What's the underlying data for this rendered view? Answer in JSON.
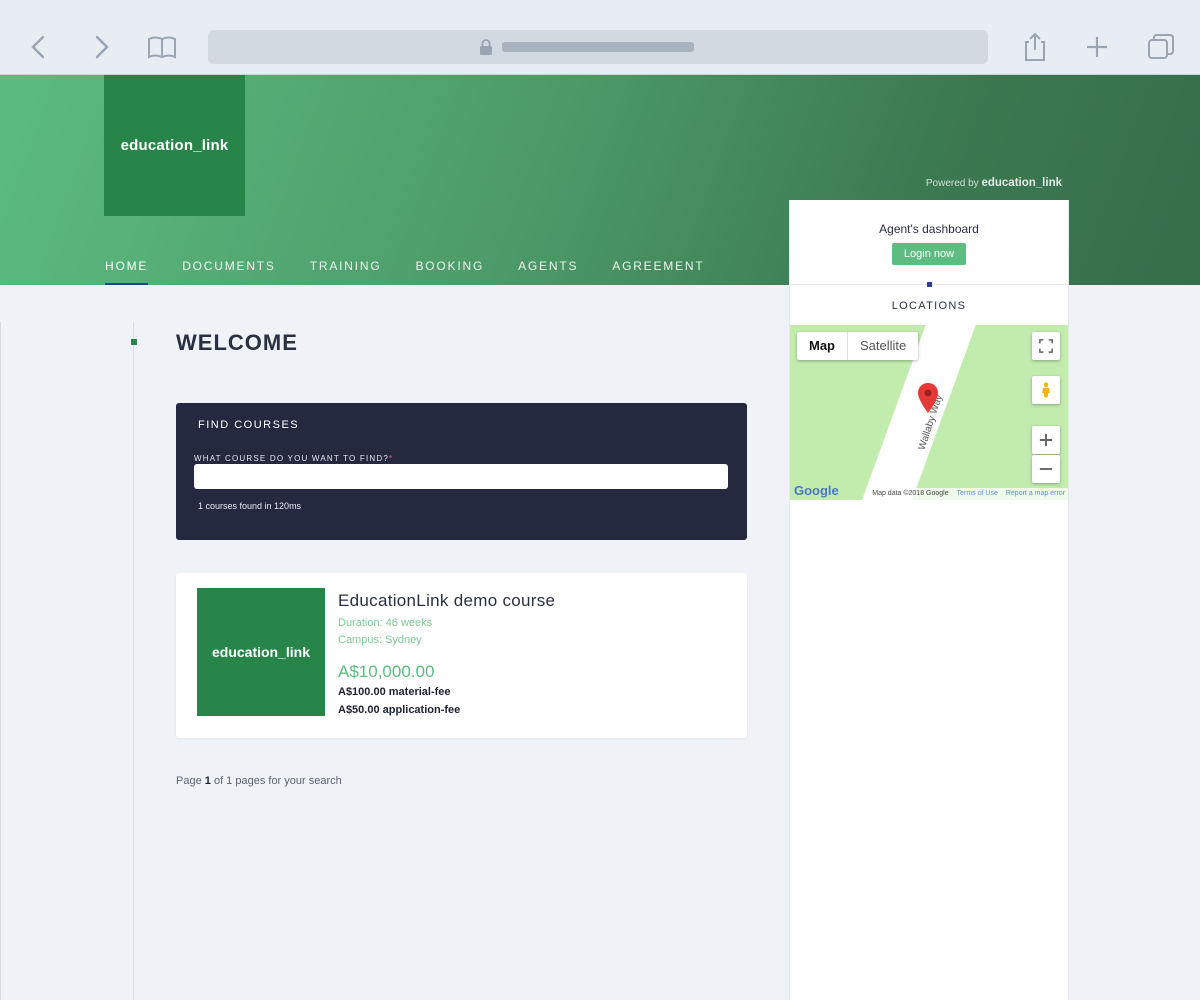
{
  "header": {
    "logo": "education_link",
    "powered_prefix": "Powered by",
    "powered_brand": "education_link",
    "nav": [
      {
        "label": "HOME",
        "active": true
      },
      {
        "label": "DOCUMENTS"
      },
      {
        "label": "TRAINING"
      },
      {
        "label": "BOOKING"
      },
      {
        "label": "AGENTS"
      },
      {
        "label": "AGREEMENT"
      }
    ]
  },
  "sidebar": {
    "agent_title": "Agent's dashboard",
    "login_label": "Login now",
    "locations_title": "LOCATIONS",
    "map": {
      "type_map": "Map",
      "type_satellite": "Satellite",
      "road_label": "Wallaby Way",
      "google": "Google",
      "attribution": "Map data ©2018 Google",
      "terms": "Terms of Use",
      "report": "Report a map error"
    }
  },
  "main": {
    "title": "WELCOME",
    "find": {
      "title": "FIND COURSES",
      "label": "WHAT COURSE DO YOU WANT TO FIND?",
      "required_mark": "*",
      "value": "",
      "result": "1 courses found in 120ms"
    },
    "course": {
      "logo": "education_link",
      "title": "EducationLink demo course",
      "duration": "Duration: 46 weeks",
      "campus": "Campus: Sydney",
      "price": "A$10,000.00",
      "fee1": "A$100.00 material-fee",
      "fee2": "A$50.00 application-fee"
    },
    "pager": {
      "prefix": "Page",
      "page": "1",
      "suffix": "of 1 pages for your search"
    }
  },
  "colors": {
    "brand_green": "#27854a",
    "accent_green": "#5dbd80",
    "panel_dark": "#242940",
    "nav_underline": "#2c3e8c"
  }
}
